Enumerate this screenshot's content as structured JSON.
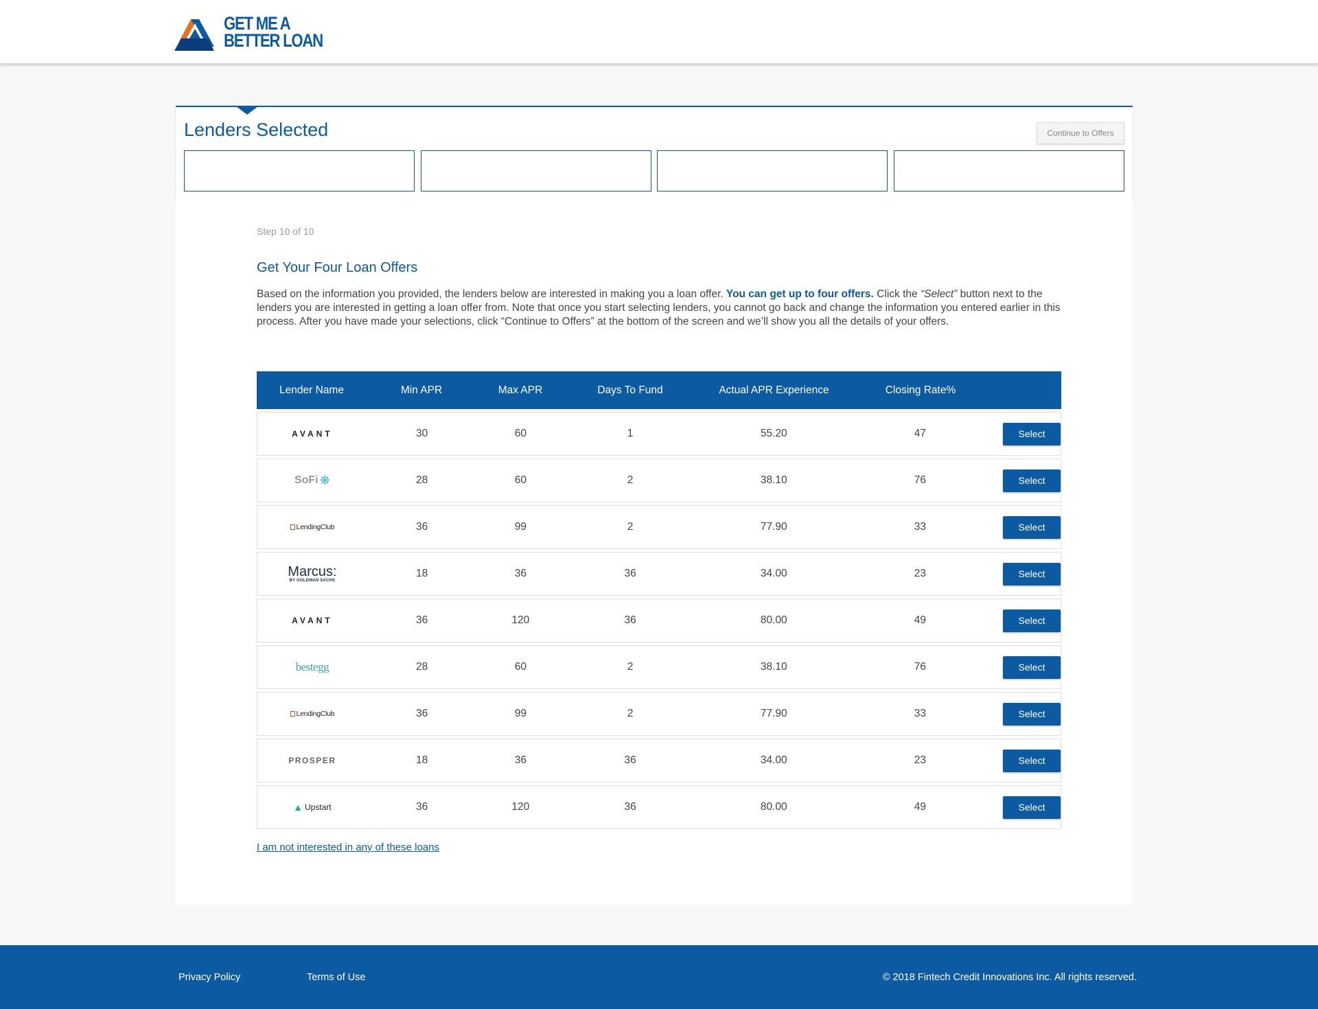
{
  "header": {
    "logo_line1": "GET ME A",
    "logo_line2": "BETTER LOAN",
    "brand_colors": {
      "orange": "#e5731f",
      "blue": "#0b5aa2",
      "navy": "#0a3d7a"
    }
  },
  "selected_panel": {
    "title": "Lenders Selected",
    "continue_label": "Continue to Offers",
    "slots": [
      "",
      "",
      "",
      ""
    ]
  },
  "step_text": "Step 10 of 10",
  "section_title": "Get Your Four Loan Offers",
  "intro": {
    "part1": "Based on the information you provided, the lenders below are interested in making you a loan offer. ",
    "bold": "You can get up to four offers.",
    "part2": " Click the ",
    "italic": "“Select”",
    "part3": " button next to the lenders you are interested in getting a loan offer from. Note that once you start selecting lenders, you cannot go back and change the information you entered earlier in this process. After you have made your selections, click “Continue to Offers” at the bottom of the screen and we’ll show you all the details of your offers."
  },
  "table": {
    "headers": [
      "Lender Name",
      "Min APR",
      "Max APR",
      "Days To Fund",
      "Actual APR Experience",
      "Closing Rate%",
      ""
    ],
    "select_label": "Select",
    "rows": [
      {
        "lender": "avant",
        "logo_text": "AVANT",
        "min_apr": "30",
        "max_apr": "60",
        "days": "1",
        "actual_apr": "55.20",
        "closing": "47"
      },
      {
        "lender": "sofi",
        "logo_text": "SoFi",
        "min_apr": "28",
        "max_apr": "60",
        "days": "2",
        "actual_apr": "38.10",
        "closing": "76"
      },
      {
        "lender": "lendingclub",
        "logo_text": "LendingClub",
        "min_apr": "36",
        "max_apr": "99",
        "days": "2",
        "actual_apr": "77.90",
        "closing": "33"
      },
      {
        "lender": "marcus",
        "logo_text": "Marcus:",
        "min_apr": "18",
        "max_apr": "36",
        "days": "36",
        "actual_apr": "34.00",
        "closing": "23"
      },
      {
        "lender": "avant",
        "logo_text": "AVANT",
        "min_apr": "36",
        "max_apr": "120",
        "days": "36",
        "actual_apr": "80.00",
        "closing": "49"
      },
      {
        "lender": "bestegg",
        "logo_text": "bestegg",
        "min_apr": "28",
        "max_apr": "60",
        "days": "2",
        "actual_apr": "38.10",
        "closing": "76"
      },
      {
        "lender": "lendingclub",
        "logo_text": "LendingClub",
        "min_apr": "36",
        "max_apr": "99",
        "days": "2",
        "actual_apr": "77.90",
        "closing": "33"
      },
      {
        "lender": "prosper",
        "logo_text": "PROSPER",
        "min_apr": "18",
        "max_apr": "36",
        "days": "36",
        "actual_apr": "34.00",
        "closing": "23"
      },
      {
        "lender": "upstart",
        "logo_text": "Upstart",
        "min_apr": "36",
        "max_apr": "120",
        "days": "36",
        "actual_apr": "80.00",
        "closing": "49"
      }
    ]
  },
  "not_interested_link": "I am not interested in any of these loans",
  "footer": {
    "privacy": "Privacy Policy",
    "terms": "Terms of Use",
    "copyright": "© 2018 Fintech Credit Innovations Inc. All rights reserved."
  }
}
